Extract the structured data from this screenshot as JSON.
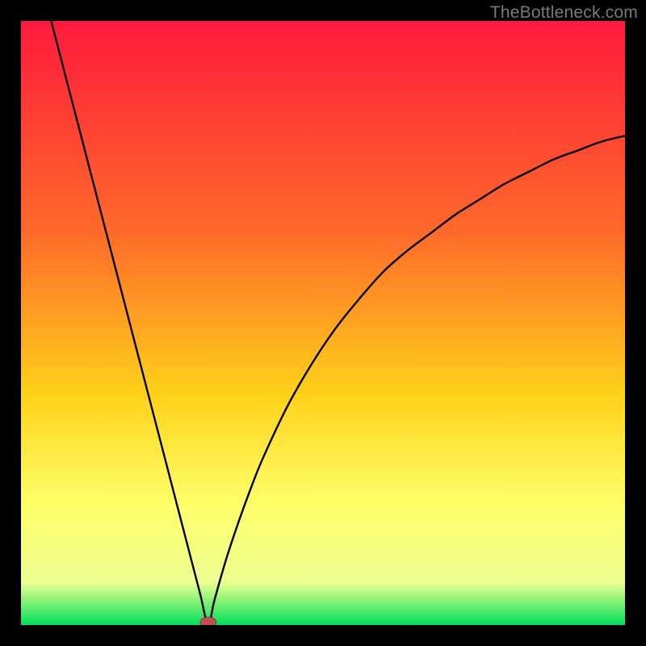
{
  "watermark": "TheBottleneck.com",
  "colors": {
    "frame": "#000000",
    "gradient_top": "#ff1a3c",
    "gradient_mid1": "#ff6a2a",
    "gradient_mid2": "#ffd21a",
    "gradient_mid3": "#ffff6a",
    "gradient_mid4": "#ecff90",
    "gradient_bottom": "#00e05a",
    "curve": "#000000",
    "marker_fill": "#c05050",
    "marker_stroke": "#804040"
  },
  "chart_data": {
    "type": "line",
    "title": "",
    "xlabel": "",
    "ylabel": "",
    "xlim": [
      0,
      100
    ],
    "ylim": [
      0,
      100
    ],
    "grid": false,
    "legend": false,
    "notes": "V-shaped curve over a vertical red→orange→yellow→green gradient. Minimum (green zone) near x≈31, y≈0. Left branch rises steeply to top-left corner (x≈5, y≈100). Right branch rises with decreasing slope toward x=100, y≈81.",
    "x": [
      5.0,
      6.3,
      7.6,
      8.9,
      10.2,
      11.5,
      12.8,
      14.1,
      15.4,
      16.7,
      18.0,
      19.3,
      20.6,
      21.9,
      23.2,
      24.5,
      25.8,
      27.1,
      28.4,
      29.7,
      31.0,
      32.0,
      34.0,
      36.0,
      38.0,
      40.0,
      44.0,
      48.0,
      52.0,
      56.0,
      60.0,
      64.0,
      68.0,
      72.0,
      76.0,
      80.0,
      84.0,
      88.0,
      92.0,
      96.0,
      100.0
    ],
    "values": [
      100.0,
      95.0,
      90.0,
      85.0,
      80.0,
      75.0,
      70.0,
      65.0,
      60.0,
      55.0,
      50.0,
      45.0,
      40.0,
      35.0,
      30.0,
      25.0,
      20.0,
      15.0,
      10.0,
      5.0,
      0.0,
      4.0,
      11.0,
      17.0,
      22.5,
      27.5,
      36.0,
      43.0,
      49.0,
      54.0,
      58.5,
      62.0,
      65.0,
      68.0,
      70.5,
      73.0,
      75.0,
      77.0,
      78.5,
      80.0,
      81.0
    ],
    "marker": {
      "x": 31.0,
      "y": 0.5
    }
  }
}
